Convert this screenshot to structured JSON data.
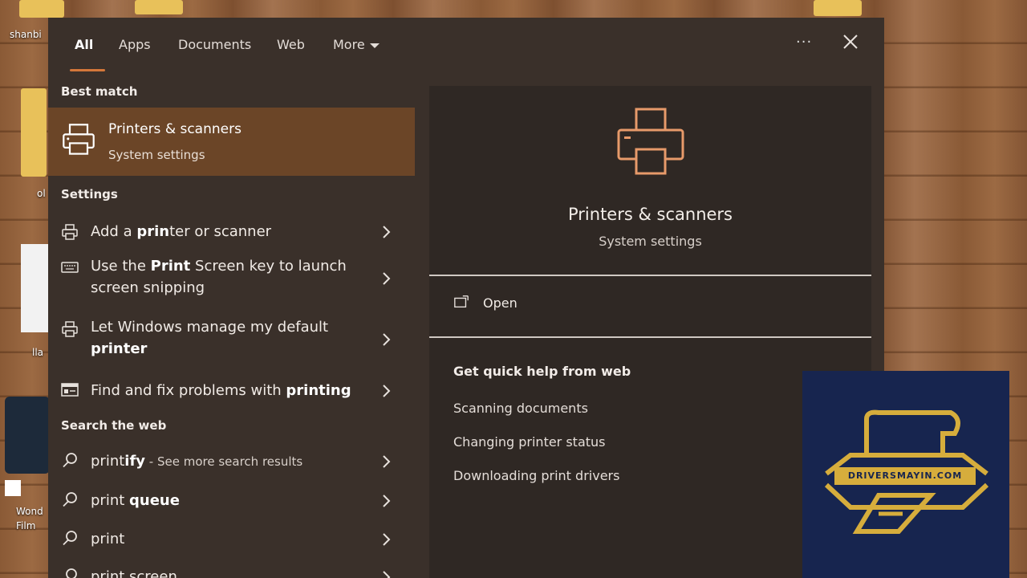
{
  "desktop": {
    "icons": [
      {
        "label": "shanbi"
      },
      {
        "label": "ol"
      },
      {
        "label": "lla"
      },
      {
        "label": "Wond Film"
      }
    ]
  },
  "tabs": [
    {
      "label": "All"
    },
    {
      "label": "Apps"
    },
    {
      "label": "Documents"
    },
    {
      "label": "Web"
    },
    {
      "label": "More"
    }
  ],
  "top_actions": {
    "more_options": "···"
  },
  "best_match": {
    "header": "Best match",
    "title": "Printers & scanners",
    "subtitle": "System settings",
    "icon": "printer-icon"
  },
  "settings": {
    "header": "Settings",
    "items": [
      {
        "pre": "Add a ",
        "bold": "prin",
        "post": "ter or scanner",
        "icon": "printer-icon"
      },
      {
        "pre": "Use the ",
        "bold": "Print",
        "post": " Screen key to launch",
        "line2": "screen snipping",
        "icon": "keyboard-icon"
      },
      {
        "pre": "Let Windows manage my default",
        "bold": "",
        "post": "",
        "line2_bold": "printer",
        "icon": "printer-icon"
      },
      {
        "pre": "Find and fix problems with ",
        "bold": "printing",
        "post": "",
        "icon": "troubleshoot-icon"
      }
    ]
  },
  "web": {
    "header": "Search the web",
    "items": [
      {
        "pre": "print",
        "bold": "ify",
        "post": "",
        "extra": " - See more search results"
      },
      {
        "pre": "print ",
        "bold": "queue",
        "post": "",
        "extra": ""
      },
      {
        "pre": "print",
        "bold": "",
        "post": "",
        "extra": ""
      },
      {
        "pre": "print screen",
        "bold": "",
        "post": "",
        "extra": ""
      }
    ]
  },
  "preview": {
    "title": "Printers & scanners",
    "subtitle": "System settings",
    "open_label": "Open",
    "help_header": "Get quick help from web",
    "help_links": [
      {
        "label": "Scanning documents"
      },
      {
        "label": "Changing printer status"
      },
      {
        "label": "Downloading print drivers"
      }
    ]
  },
  "watermark": {
    "text": "DRIVERSMAYIN.COM"
  },
  "colors": {
    "panel_bg": "#3a302a",
    "preview_bg": "#2f2824",
    "highlight": "#6b4527",
    "accent": "#d4773a",
    "printer_icon": "#e79a6a",
    "logo_bg": "#17254f",
    "logo_gold": "#d6ad3c"
  }
}
